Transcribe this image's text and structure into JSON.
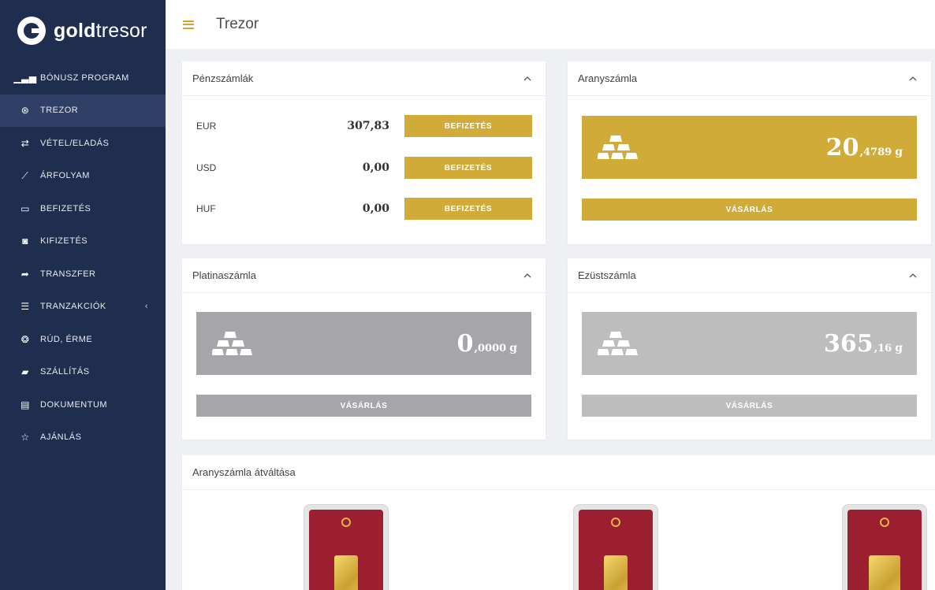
{
  "app": {
    "brand_bold": "gold",
    "brand_light": "tresor"
  },
  "sidebar": {
    "items": [
      {
        "label": "BÓNUSZ PROGRAM",
        "icon": "bar-chart-icon",
        "glyph": "▁▃▅",
        "active": false
      },
      {
        "label": "TREZOR",
        "icon": "vault-icon",
        "glyph": "⊛",
        "active": true
      },
      {
        "label": "VÉTEL/ELADÁS",
        "icon": "exchange-icon",
        "glyph": "⇄",
        "active": false
      },
      {
        "label": "ÁRFOLYAM",
        "icon": "line-chart-icon",
        "glyph": "⟋",
        "active": false
      },
      {
        "label": "BEFIZETÉS",
        "icon": "credit-card-icon",
        "glyph": "▭",
        "active": false
      },
      {
        "label": "KIFIZETÉS",
        "icon": "money-icon",
        "glyph": "◙",
        "active": false
      },
      {
        "label": "TRANSZFER",
        "icon": "share-arrow-icon",
        "glyph": "➦",
        "active": false
      },
      {
        "label": "TRANZAKCIÓK",
        "icon": "list-icon",
        "glyph": "☰",
        "active": false,
        "has_submenu": true
      },
      {
        "label": "RÚD, ÉRME",
        "icon": "coins-icon",
        "glyph": "❂",
        "active": false
      },
      {
        "label": "SZÁLLÍTÁS",
        "icon": "truck-icon",
        "glyph": "▰",
        "active": false
      },
      {
        "label": "DOKUMENTUM",
        "icon": "document-icon",
        "glyph": "▤",
        "active": false
      },
      {
        "label": "AJÁNLÁS",
        "icon": "star-icon",
        "glyph": "☆",
        "active": false
      }
    ],
    "submenu_chevron": "‹"
  },
  "header": {
    "title": "Trezor"
  },
  "cash_accounts": {
    "title": "Pénzszámlák",
    "rows": [
      {
        "currency": "EUR",
        "amount": "307,83",
        "button": "BEFIZETÉS"
      },
      {
        "currency": "USD",
        "amount": "0,00",
        "button": "BEFIZETÉS"
      },
      {
        "currency": "HUF",
        "amount": "0,00",
        "button": "BEFIZETÉS"
      }
    ]
  },
  "gold_account": {
    "title": "Aranyszámla",
    "value_int": "20",
    "value_dec": ",4789",
    "unit": "g",
    "buy_label": "VÁSÁRLÁS",
    "color": "#d1ab38"
  },
  "platinum_account": {
    "title": "Platinaszámla",
    "value_int": "0",
    "value_dec": ",0000",
    "unit": "g",
    "buy_label": "VÁSÁRLÁS",
    "color": "#a6a6aa"
  },
  "silver_account": {
    "title": "Ezüstszámla",
    "value_int": "365",
    "value_dec": ",16",
    "unit": "g",
    "buy_label": "VÁSÁRLÁS",
    "color": "#bdbdbd"
  },
  "conversion": {
    "title": "Aranyszámla átváltása"
  },
  "colors": {
    "sidebar_bg": "#1f2d4e",
    "sidebar_active": "#2f3f65",
    "accent_gold": "#d1ab38"
  }
}
